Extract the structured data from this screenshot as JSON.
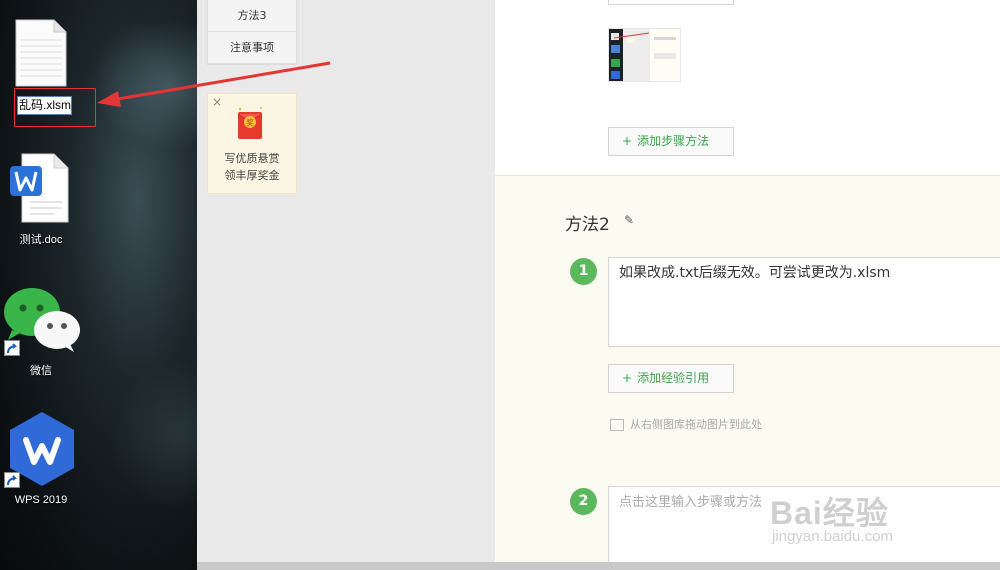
{
  "desktop": {
    "rename_value": "乱码.xlsm",
    "doc_label": "测试.doc",
    "wechat_label": "微信",
    "wps_label": "WPS 2019"
  },
  "sidebar_nav": {
    "items": [
      {
        "label": "方法3"
      },
      {
        "label": "注意事项"
      }
    ]
  },
  "reward": {
    "close": "×",
    "gift_char": "奖",
    "line1": "写优质悬赏",
    "line2": "领丰厚奖金"
  },
  "editor": {
    "add_step_button": "添加步骤方法",
    "method_title": "方法2",
    "steps": [
      {
        "num": "1",
        "text": "如果改成.txt后缀无效。可尝试更改为.xlsm"
      },
      {
        "num": "2",
        "placeholder": "点击这里输入步骤或方法"
      }
    ],
    "add_reference_button": "添加经验引用",
    "drag_hint": "从右侧图库拖动图片到此处"
  },
  "watermark": {
    "brand": "Bai经验",
    "url": "jingyan.baidu.com"
  },
  "colors": {
    "accent_green": "#5cb85c",
    "button_text_green": "#3aa34d",
    "highlight_red": "#e43535"
  }
}
